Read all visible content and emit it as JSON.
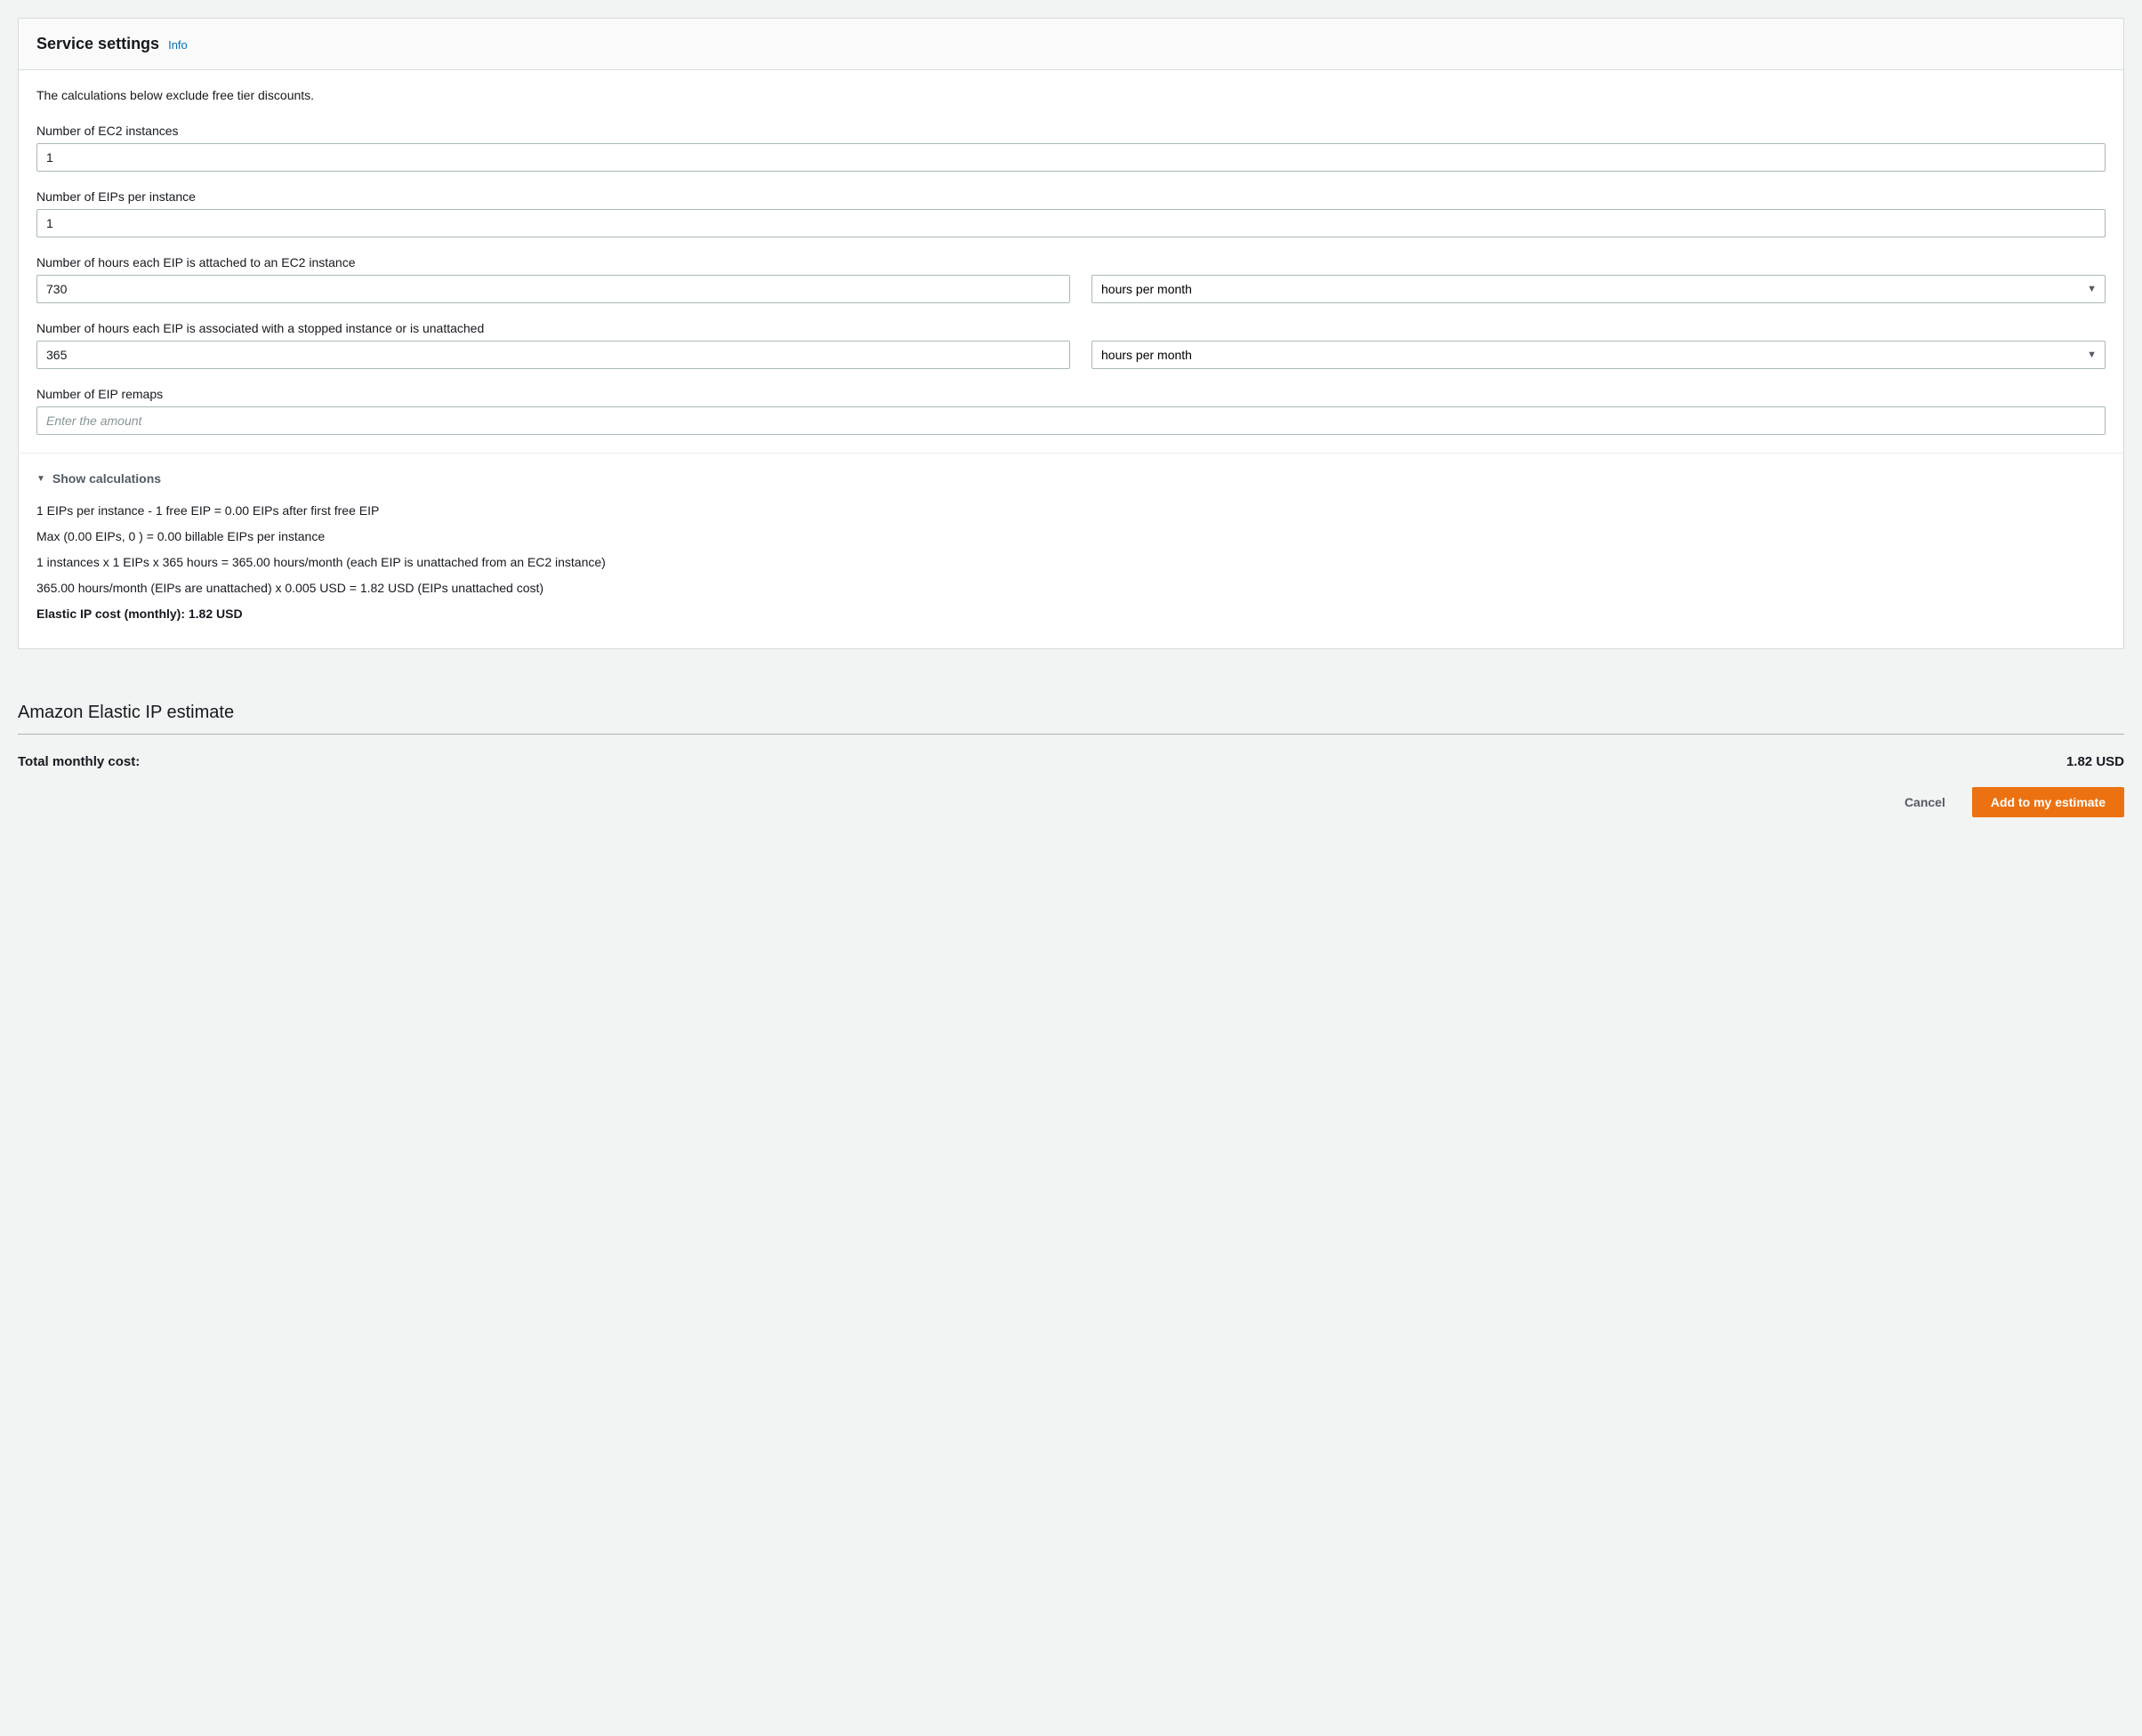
{
  "panel": {
    "title": "Service settings",
    "info_link": "Info",
    "notice": "The calculations below exclude free tier discounts.",
    "fields": {
      "ec2_instances": {
        "label": "Number of EC2 instances",
        "value": "1"
      },
      "eips_per_instance": {
        "label": "Number of EIPs per instance",
        "value": "1"
      },
      "hours_attached": {
        "label": "Number of hours each EIP is attached to an EC2 instance",
        "value": "730",
        "unit_selected": "hours per month"
      },
      "hours_unattached": {
        "label": "Number of hours each EIP is associated with a stopped instance or is unattached",
        "value": "365",
        "unit_selected": "hours per month"
      },
      "remaps": {
        "label": "Number of EIP remaps",
        "placeholder": "Enter the amount",
        "value": ""
      }
    },
    "calc": {
      "toggle_label": "Show calculations",
      "lines": [
        "1 EIPs per instance - 1 free EIP = 0.00 EIPs after first free EIP",
        "Max (0.00 EIPs, 0 ) = 0.00 billable EIPs per instance",
        "1 instances x 1 EIPs x 365 hours = 365.00 hours/month (each EIP is unattached from an EC2 instance)",
        "365.00 hours/month (EIPs are unattached) x 0.005 USD = 1.82 USD (EIPs unattached cost)"
      ],
      "total_label": "Elastic IP cost (monthly): 1.82 USD"
    }
  },
  "estimate": {
    "title": "Amazon Elastic IP estimate",
    "total_label": "Total monthly cost:",
    "total_value": "1.82 USD"
  },
  "actions": {
    "cancel": "Cancel",
    "add": "Add to my estimate"
  }
}
